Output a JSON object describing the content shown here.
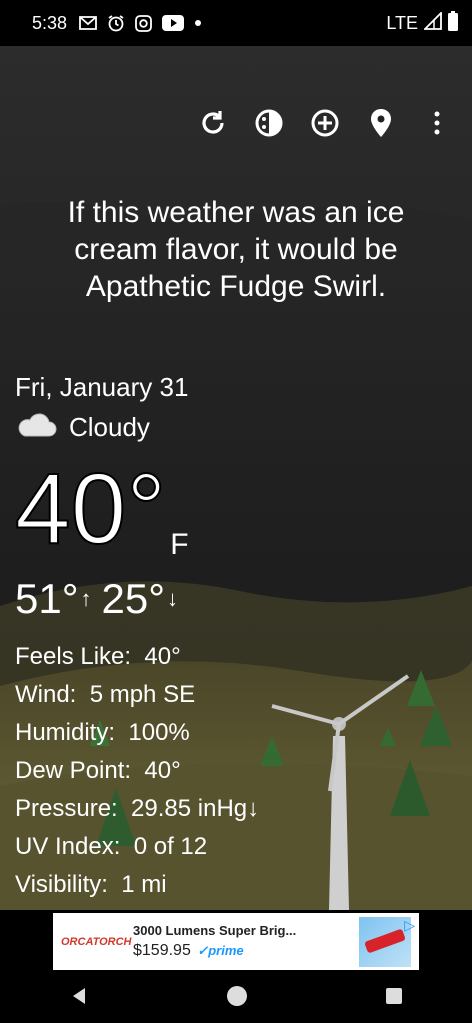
{
  "status_bar": {
    "time": "5:38",
    "network": "LTE",
    "icons": [
      "gmail-icon",
      "alarm-icon",
      "instagram-icon",
      "youtube-icon",
      "dot-icon",
      "signal-icon",
      "battery-icon"
    ]
  },
  "toolbar": {
    "icons": [
      "refresh-icon",
      "theme-icon",
      "add-location-icon",
      "location-pin-icon",
      "more-options-icon"
    ]
  },
  "quote": "If this weather was an ice cream flavor, it would be Apathetic Fudge Swirl.",
  "weather": {
    "date": "Fri, January 31",
    "condition": "Cloudy",
    "temperature": "40°",
    "unit": "F",
    "high": "51°",
    "low": "25°",
    "details": [
      {
        "label": "Feels Like:",
        "value": "40°"
      },
      {
        "label": "Wind:",
        "value": "5 mph SE"
      },
      {
        "label": "Humidity:",
        "value": "100%"
      },
      {
        "label": "Dew Point:",
        "value": "40°"
      },
      {
        "label": "Pressure:",
        "value": "29.85 inHg↓"
      },
      {
        "label": "UV Index:",
        "value": "0 of 12"
      },
      {
        "label": "Visibility:",
        "value": "1 mi"
      }
    ]
  },
  "ad": {
    "brand": "ORCATORCH",
    "title": "3000 Lumens Super Brig...",
    "price": "$159.95",
    "prime": "prime"
  },
  "nav": {
    "icons": [
      "back-icon",
      "home-icon",
      "recents-icon"
    ]
  },
  "colors": {
    "sky_top": "#2a2a2a",
    "ground": "#6e6a3c",
    "tree": "#356b32",
    "prime_blue": "#1a98ff"
  }
}
